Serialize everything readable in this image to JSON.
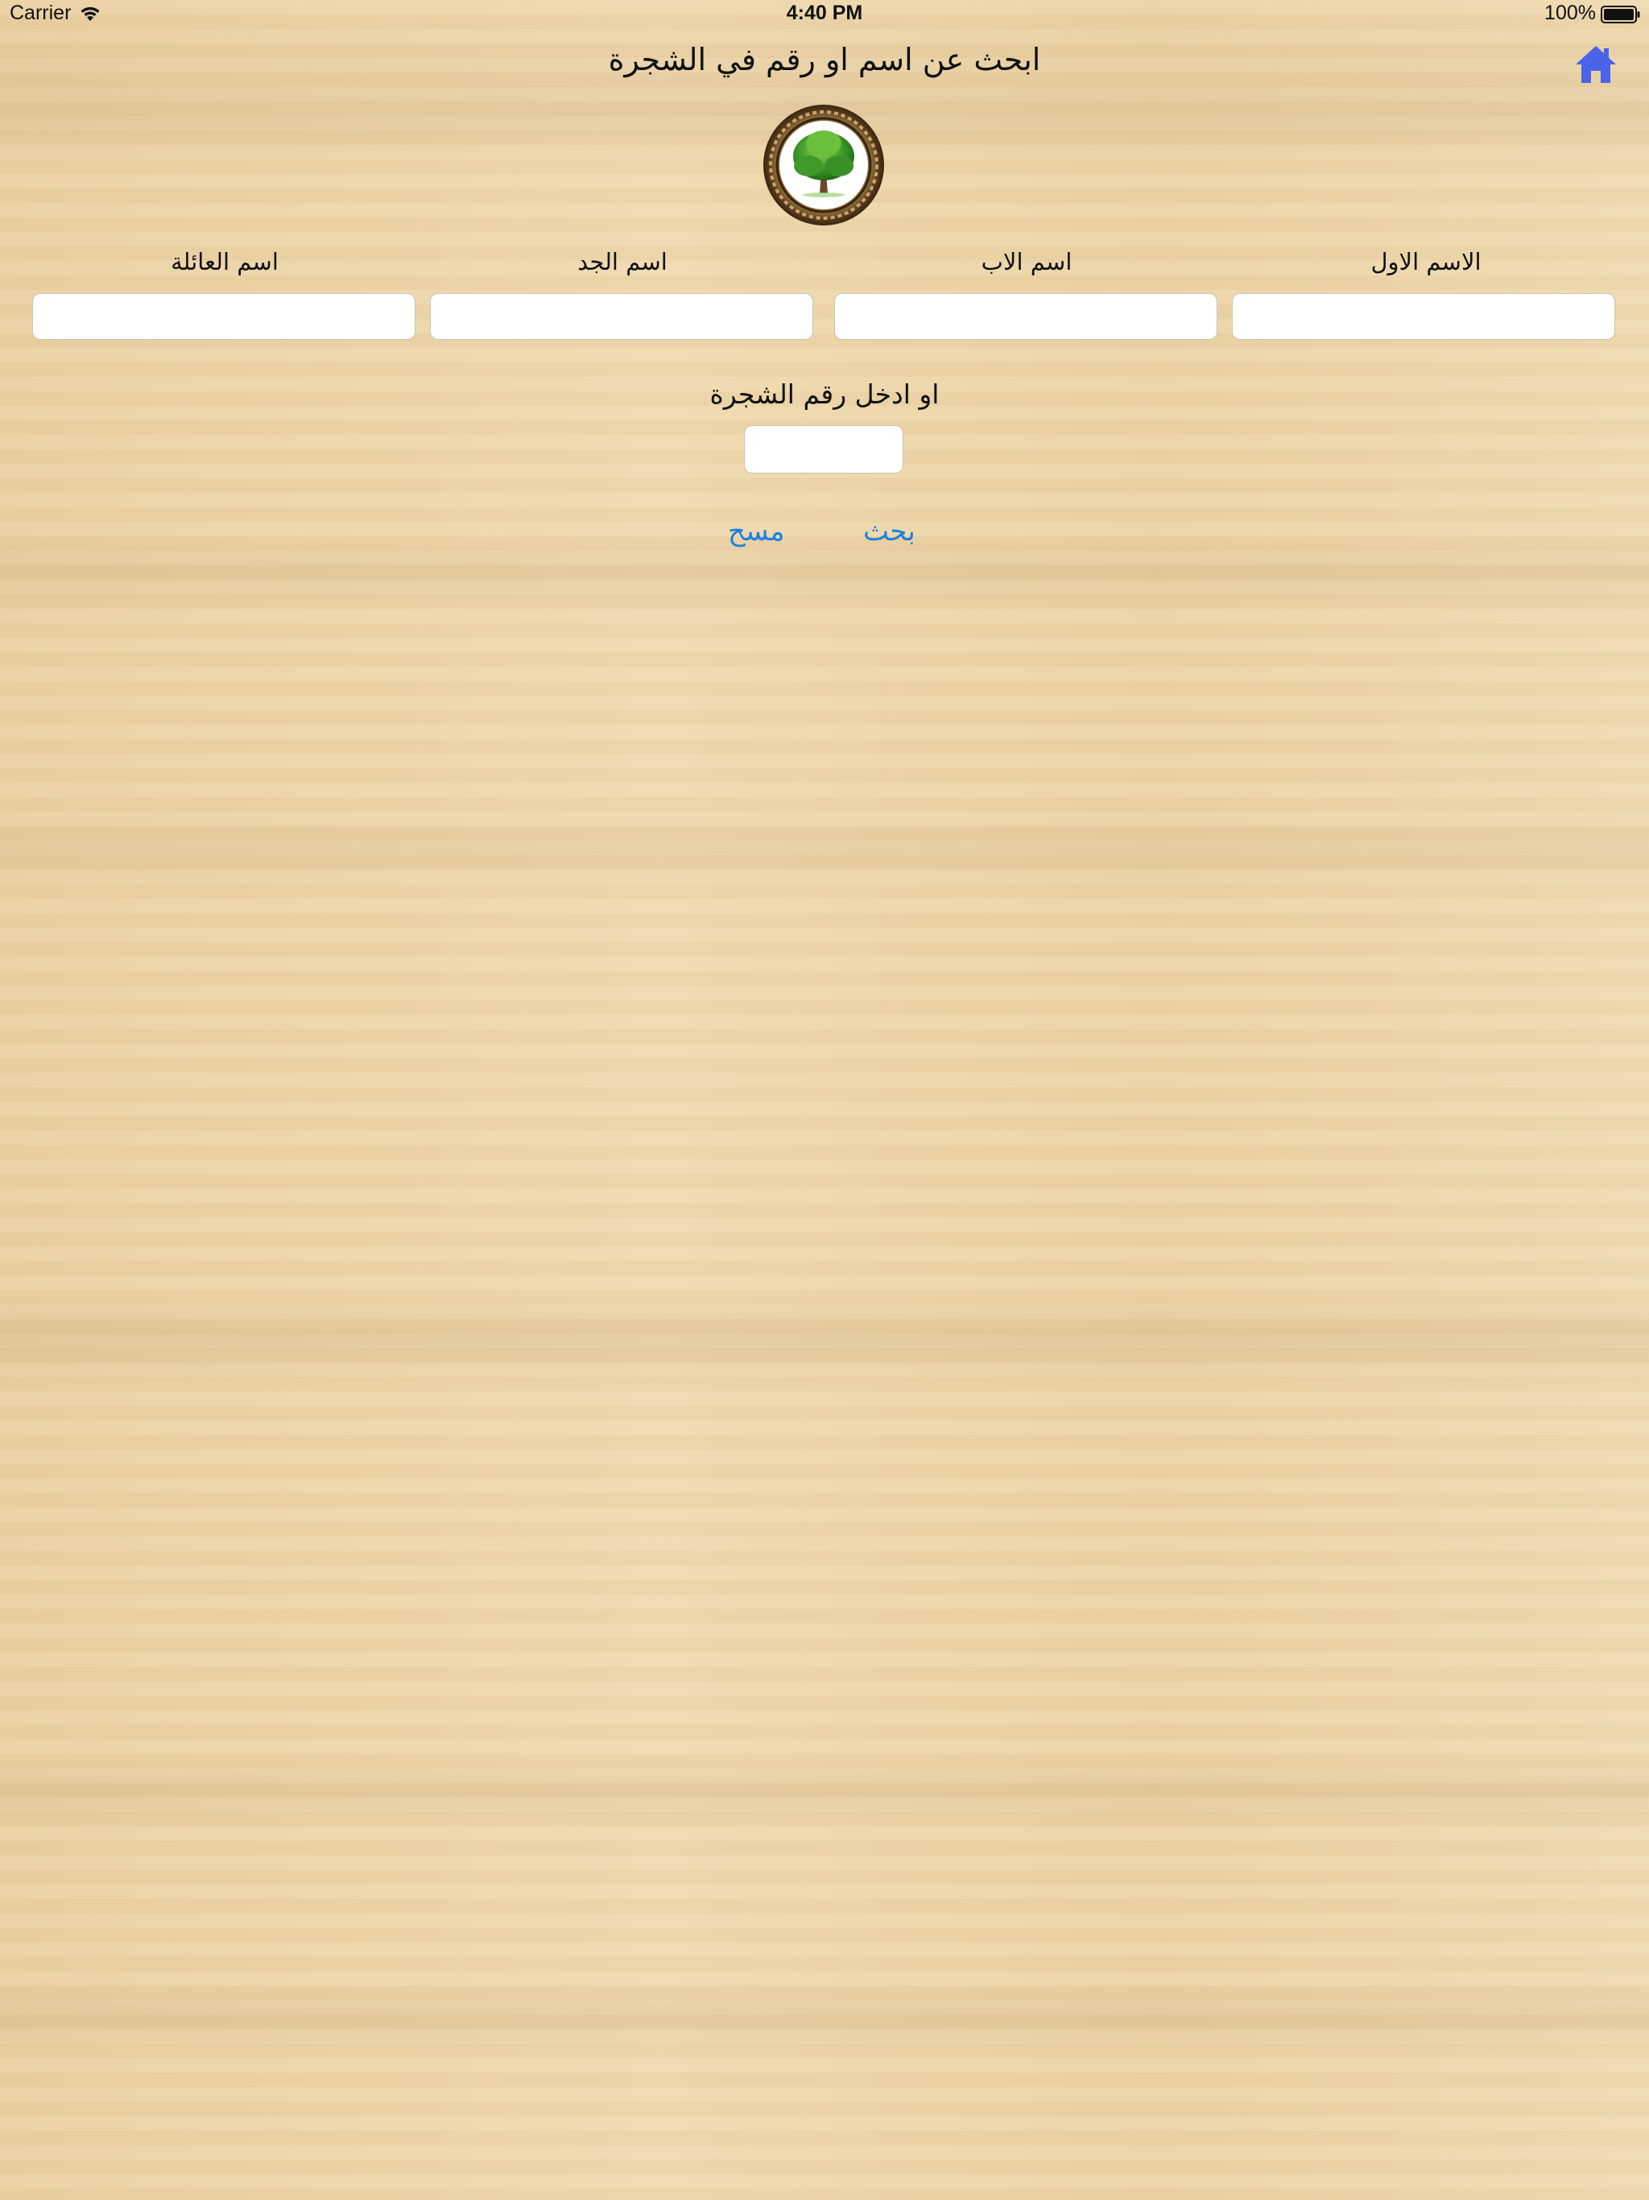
{
  "status_bar": {
    "carrier": "Carrier",
    "time": "4:40 PM",
    "battery": "100%"
  },
  "header": {
    "title": "ابحث عن اسم او رقم في الشجرة",
    "home_icon": "home-icon",
    "home_icon_color": "#4a63e8"
  },
  "logo": {
    "icon": "tree-logo-icon"
  },
  "form": {
    "fields": [
      {
        "label": "الاسم الاول",
        "value": ""
      },
      {
        "label": "اسم الاب",
        "value": ""
      },
      {
        "label": "اسم الجد",
        "value": ""
      },
      {
        "label": "اسم العائلة",
        "value": ""
      }
    ],
    "tree_number_label": "او ادخل رقم الشجرة",
    "tree_number_value": ""
  },
  "actions": {
    "search_label": "بحث",
    "clear_label": "مسح",
    "link_color": "#1f7fe0"
  }
}
